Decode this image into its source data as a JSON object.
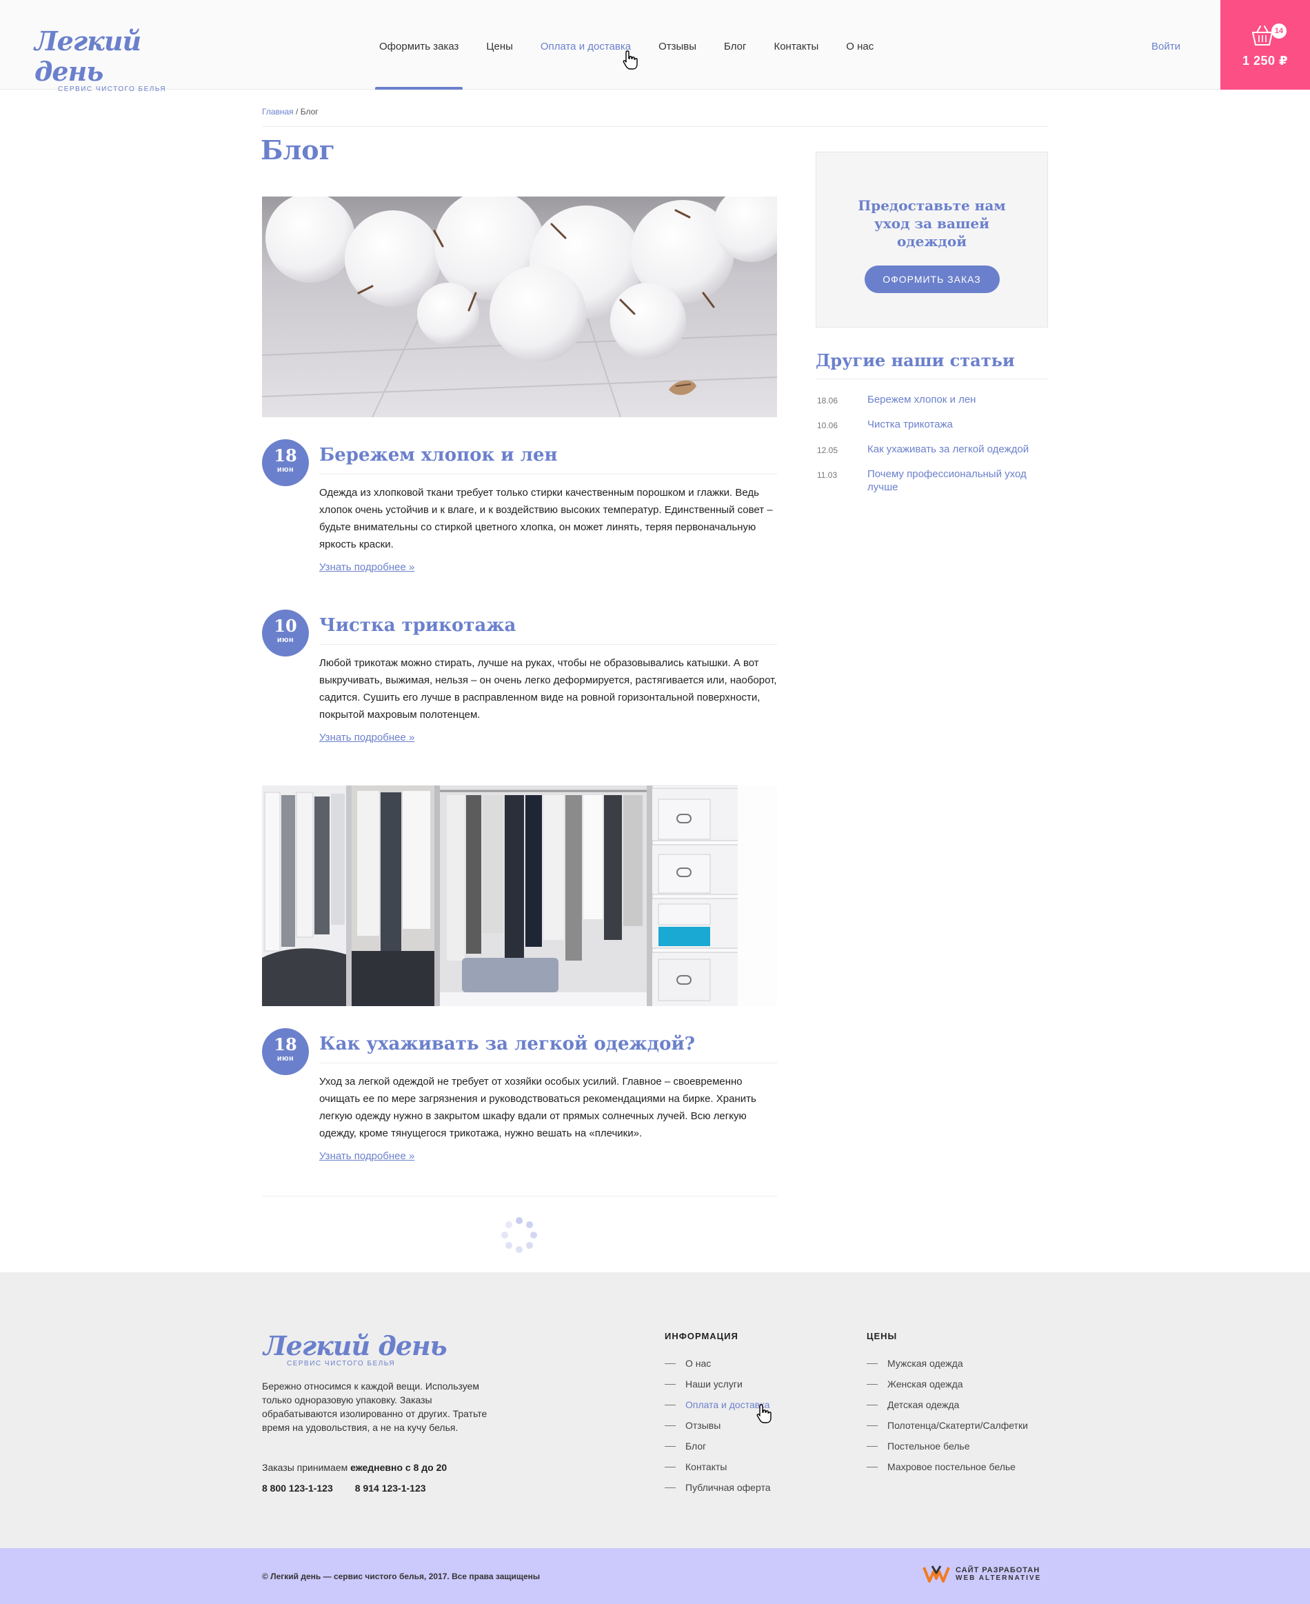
{
  "header": {
    "logo_title": "Легкий день",
    "logo_subtitle": "СЕРВИС ЧИСТОГО БЕЛЬЯ",
    "nav": [
      {
        "label": "Оформить заказ"
      },
      {
        "label": "Цены"
      },
      {
        "label": "Оплата и доставка"
      },
      {
        "label": "Отзывы"
      },
      {
        "label": "Блог"
      },
      {
        "label": "Контакты"
      },
      {
        "label": "О нас"
      }
    ],
    "login": "Войти",
    "cart": {
      "count": "14",
      "total": "1 250 ₽"
    }
  },
  "breadcrumb": {
    "home": "Главная",
    "separator": " / ",
    "current": "Блог"
  },
  "page_title": "Блог",
  "posts": [
    {
      "day": "18",
      "month": "июн",
      "title": "Бережем хлопок и лен",
      "text": "Одежда из хлопковой ткани требует только стирки качественным порошком и глажки. Ведь хлопок очень устойчив и к влаге, и к воздействию высоких температур. Единственный совет – будьте внимательны со стиркой цветного хлопка, он может линять, теряя первоначальную яркость краски.",
      "more": "Узнать подробнее »"
    },
    {
      "day": "10",
      "month": "июн",
      "title": "Чистка трикотажа",
      "text": "Любой трикотаж можно стирать, лучше на руках, чтобы не образовывались катышки. А вот выкручивать, выжимая, нельзя – он очень легко деформируется, растягивается или, наоборот, садится. Сушить его лучше в расправленном виде на ровной горизонтальной поверхности, покрытой махровым полотенцем.",
      "more": "Узнать подробнее »"
    },
    {
      "day": "18",
      "month": "июн",
      "title": "Как ухаживать за легкой одеждой?",
      "text": "Уход за легкой одеждой не требует от хозяйки особых усилий. Главное – своевременно очищать ее по мере загрязнения и руководствоваться рекомендациями на бирке. Хранить легкую одежду нужно в закрытом шкафу вдали от прямых солнечных лучей. Всю легкую одежду, кроме тянущегося трикотажа, нужно вешать на «плечики».",
      "more": "Узнать подробнее »"
    }
  ],
  "sidebar": {
    "promo_text": "Предоставьте нам уход за вашей одеждой",
    "promo_button": "Оформить заказ",
    "articles_title": "Другие наши статьи",
    "articles": [
      {
        "date": "18.06",
        "title": "Бережем хлопок и лен"
      },
      {
        "date": "10.06",
        "title": "Чистка трикотажа"
      },
      {
        "date": "12.05",
        "title": "Как ухаживать за легкой одеждой"
      },
      {
        "date": "11.03",
        "title": "Почему профессиональный уход лучше"
      }
    ]
  },
  "footer": {
    "logo_title": "Легкий день",
    "logo_subtitle": "СЕРВИС ЧИСТОГО БЕЛЬЯ",
    "about": "Бережно относимся к каждой вещи. Используем только одноразовую упаковку.  Заказы обрабатываются изолированно от других. Тратьте время на удовольствия, а не на кучу белья.",
    "hours_prefix": "Заказы  принимаем ",
    "hours_value": "ежедневно с 8 до 20",
    "phone1": "8 800 123-1-123",
    "phone2": "8 914  123-1-123",
    "info_title": "Информация",
    "info_links": [
      "О нас",
      "Наши услуги",
      "Оплата и доставка",
      "Отзывы",
      "Блог",
      "Контакты",
      "Публичная оферта"
    ],
    "prices_title": "Цены",
    "price_links": [
      "Мужская одежда",
      "Женская одежда",
      "Детская одежда",
      "Полотенца/Скатерти/Салфетки",
      "Постельное белье",
      "Махровое постельное белье"
    ],
    "copyright": "© Легкий день — сервис чистого белья, 2017. Все права защищены",
    "dev_line1": "САЙТ РАЗРАБОТАН",
    "dev_line2": "WEB ALTERNATIVE"
  },
  "colors": {
    "accent": "#6b80cc",
    "cart": "#fc4f86",
    "footer_bar": "#ccc9fc",
    "footer_bg": "#eeeeee"
  }
}
